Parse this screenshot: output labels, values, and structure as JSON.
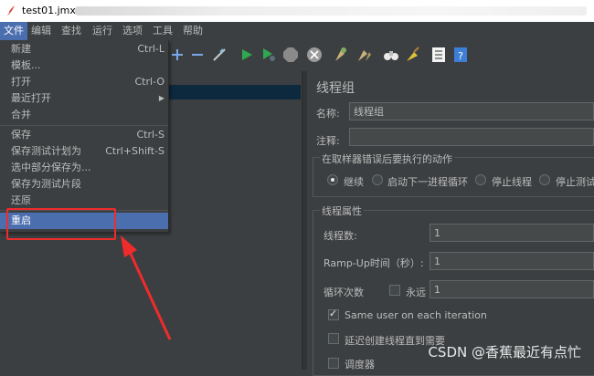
{
  "window": {
    "title": "test01.jmx"
  },
  "menubar": [
    "文件",
    "编辑",
    "查找",
    "运行",
    "选项",
    "工具",
    "帮助"
  ],
  "file_menu": {
    "items": [
      {
        "label": "新建",
        "shortcut": "Ctrl-L"
      },
      {
        "label": "模板...",
        "shortcut": ""
      },
      {
        "label": "打开",
        "shortcut": "Ctrl-O"
      },
      {
        "label": "最近打开",
        "shortcut": "▶"
      },
      {
        "label": "合并",
        "shortcut": ""
      },
      {
        "label": "保存",
        "shortcut": "Ctrl-S"
      },
      {
        "label": "保存测试计划为",
        "shortcut": "Ctrl+Shift-S"
      },
      {
        "label": "选中部分保存为...",
        "shortcut": ""
      },
      {
        "label": "保存为测试片段",
        "shortcut": ""
      },
      {
        "label": "还原",
        "shortcut": ""
      },
      {
        "label": "重启",
        "shortcut": ""
      }
    ]
  },
  "panel": {
    "title": "线程组",
    "name_label": "名称:",
    "name_value": "线程组",
    "comment_label": "注释:",
    "comment_value": "",
    "error_group_label": "在取样器错误后要执行的动作",
    "error_options": [
      "继续",
      "启动下一进程循环",
      "停止线程",
      "停止测试"
    ],
    "selected_error_option": "继续",
    "thread_props_label": "线程属性",
    "threads_label": "线程数:",
    "threads_value": "1",
    "rampup_label": "Ramp-Up时间（秒）:",
    "rampup_value": "1",
    "loop_label": "循环次数",
    "forever_label": "永远",
    "loop_value": "1",
    "same_user_label": "Same user on each iteration",
    "same_user_checked": true,
    "delay_label": "延迟创建线程直到需要",
    "delay_checked": false,
    "scheduler_label": "调度器",
    "scheduler_checked": false
  },
  "watermark": "CSDN @香蕉最近有点忙",
  "colors": {
    "accent": "#4b6eaf",
    "highlight_box": "#ef2b2b",
    "background": "#3c3f41"
  }
}
